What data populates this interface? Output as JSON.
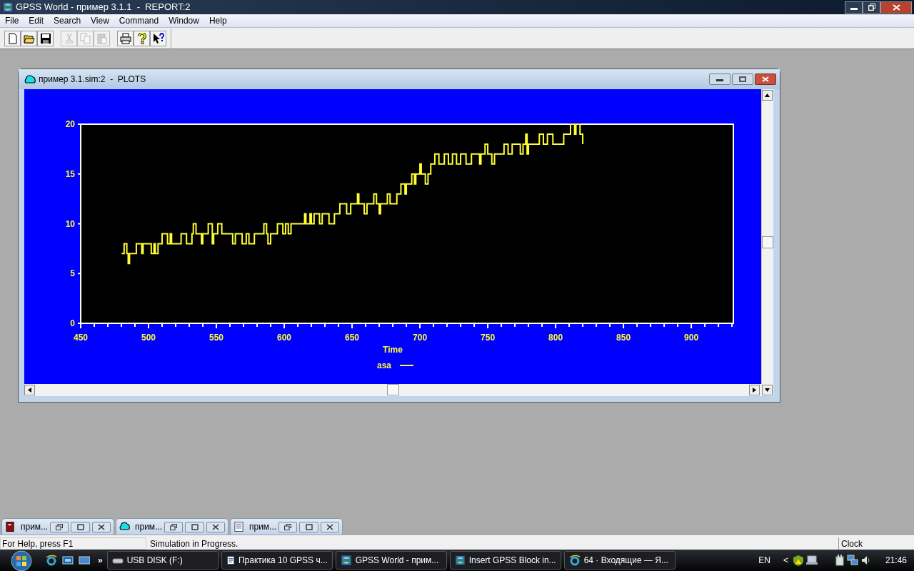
{
  "window": {
    "title": "GPSS World - пример 3.1.1  -  REPORT:2"
  },
  "menu": [
    "File",
    "Edit",
    "Search",
    "View",
    "Command",
    "Window",
    "Help"
  ],
  "toolbar": [
    {
      "kind": "new",
      "disabled": false
    },
    {
      "kind": "open",
      "disabled": false
    },
    {
      "kind": "save",
      "disabled": false
    },
    {
      "kind": "cut",
      "disabled": true
    },
    {
      "kind": "copy",
      "disabled": true
    },
    {
      "kind": "paste",
      "disabled": true
    },
    {
      "kind": "print",
      "disabled": false
    },
    {
      "kind": "help",
      "disabled": false
    },
    {
      "kind": "context-help",
      "disabled": false
    }
  ],
  "plot_window": {
    "title": "пример 3.1.sim:2  -  PLOTS",
    "chart_data": {
      "type": "line",
      "xlabel": "Time",
      "xlim": [
        450,
        931
      ],
      "ylim": [
        0,
        20
      ],
      "xticks": [
        450,
        500,
        550,
        600,
        650,
        700,
        750,
        800,
        850,
        900
      ],
      "yticks": [
        0,
        5,
        10,
        15,
        20
      ],
      "x": [
        480,
        482,
        482,
        484,
        484,
        485,
        485,
        486,
        486,
        491,
        491,
        495,
        495,
        496,
        496,
        502,
        502,
        504,
        504,
        505,
        505,
        507,
        507,
        510,
        510,
        514,
        514,
        516,
        516,
        517,
        517,
        524,
        524,
        528,
        528,
        532,
        532,
        533,
        533,
        535,
        535,
        539,
        539,
        540,
        540,
        544,
        544,
        547,
        547,
        548,
        548,
        551,
        551,
        554,
        554,
        562,
        562,
        564,
        564,
        569,
        569,
        572,
        572,
        574,
        574,
        578,
        578,
        585,
        585,
        587,
        587,
        588,
        588,
        590,
        590,
        595,
        595,
        599,
        599,
        601,
        601,
        603,
        603,
        605,
        605,
        615,
        615,
        616,
        616,
        619,
        619,
        620,
        620,
        622,
        622,
        626,
        626,
        628,
        628,
        633,
        633,
        637,
        637,
        641,
        641,
        646,
        646,
        649,
        649,
        654,
        654,
        655,
        655,
        659,
        659,
        661,
        661,
        666,
        666,
        668,
        668,
        670,
        670,
        671,
        671,
        676,
        676,
        678,
        678,
        683,
        683,
        686,
        686,
        689,
        689,
        690,
        690,
        694,
        694,
        696,
        696,
        697,
        697,
        700,
        700,
        701,
        701,
        704,
        704,
        706,
        706,
        708,
        708,
        711,
        711,
        714,
        714,
        718,
        718,
        721,
        721,
        724,
        724,
        727,
        727,
        730,
        730,
        734,
        734,
        738,
        738,
        744,
        744,
        745,
        745,
        748,
        748,
        750,
        750,
        753,
        753,
        755,
        755,
        762,
        762,
        765,
        765,
        768,
        768,
        774,
        774,
        776,
        776,
        778,
        778,
        779,
        779,
        780,
        780,
        788,
        788,
        791,
        791,
        794,
        794,
        798,
        798,
        806,
        806,
        811,
        811,
        814,
        814,
        815,
        815,
        818,
        818,
        820,
        820
      ],
      "series": [
        {
          "name": "asa",
          "color": "#ffff33",
          "values": [
            7,
            7,
            8,
            8,
            7,
            7,
            6,
            6,
            7,
            7,
            8,
            8,
            7,
            7,
            8,
            8,
            7,
            7,
            8,
            8,
            7,
            7,
            8,
            8,
            9,
            9,
            8,
            8,
            9,
            9,
            8,
            8,
            9,
            9,
            8,
            8,
            9,
            9,
            10,
            10,
            9,
            9,
            8,
            8,
            9,
            9,
            10,
            10,
            8,
            8,
            9,
            9,
            10,
            10,
            9,
            9,
            8,
            8,
            9,
            9,
            8,
            8,
            9,
            9,
            8,
            8,
            9,
            9,
            10,
            10,
            9,
            9,
            8,
            8,
            9,
            9,
            10,
            10,
            9,
            9,
            10,
            10,
            9,
            9,
            10,
            10,
            11,
            11,
            10,
            10,
            11,
            11,
            10,
            10,
            11,
            11,
            10,
            10,
            11,
            11,
            10,
            10,
            11,
            11,
            12,
            12,
            11,
            11,
            12,
            12,
            13,
            13,
            12,
            12,
            11,
            11,
            12,
            12,
            13,
            13,
            12,
            12,
            11,
            11,
            12,
            12,
            13,
            13,
            12,
            12,
            13,
            13,
            14,
            14,
            13,
            13,
            14,
            14,
            15,
            15,
            14,
            14,
            15,
            15,
            16,
            16,
            15,
            15,
            14,
            14,
            15,
            15,
            16,
            16,
            17,
            17,
            16,
            16,
            17,
            17,
            16,
            16,
            17,
            17,
            16,
            16,
            17,
            17,
            16,
            16,
            17,
            17,
            16,
            16,
            17,
            17,
            18,
            18,
            17,
            17,
            16,
            16,
            17,
            17,
            18,
            18,
            17,
            17,
            18,
            18,
            17,
            17,
            18,
            18,
            19,
            19,
            17,
            17,
            18,
            18,
            19,
            19,
            18,
            18,
            19,
            19,
            18,
            18,
            19,
            19,
            20,
            20,
            19,
            19,
            20,
            20,
            19,
            19,
            18
          ]
        }
      ]
    }
  },
  "minimized_windows": [
    {
      "title": "прим...",
      "kind": "report"
    },
    {
      "title": "прим...",
      "kind": "plot"
    },
    {
      "title": "прим...",
      "kind": "text"
    }
  ],
  "status_bar": {
    "help": "For Help, press F1",
    "message": "Simulation in Progress.",
    "indicator": "Clock"
  },
  "taskbar": {
    "overflow": "»",
    "tasks": [
      {
        "label": "USB DISK (F:)",
        "kind": "drive"
      },
      {
        "label": "Практика 10 GPSS ч...",
        "kind": "word"
      },
      {
        "label": "GPSS World - прим...",
        "kind": "gpss"
      },
      {
        "label": "Insert GPSS Block in...",
        "kind": "gpss"
      },
      {
        "label": "64 · Входящие — Я...",
        "kind": "browser"
      }
    ],
    "language": "EN",
    "tray_toggle": "<",
    "time": "21:46"
  }
}
